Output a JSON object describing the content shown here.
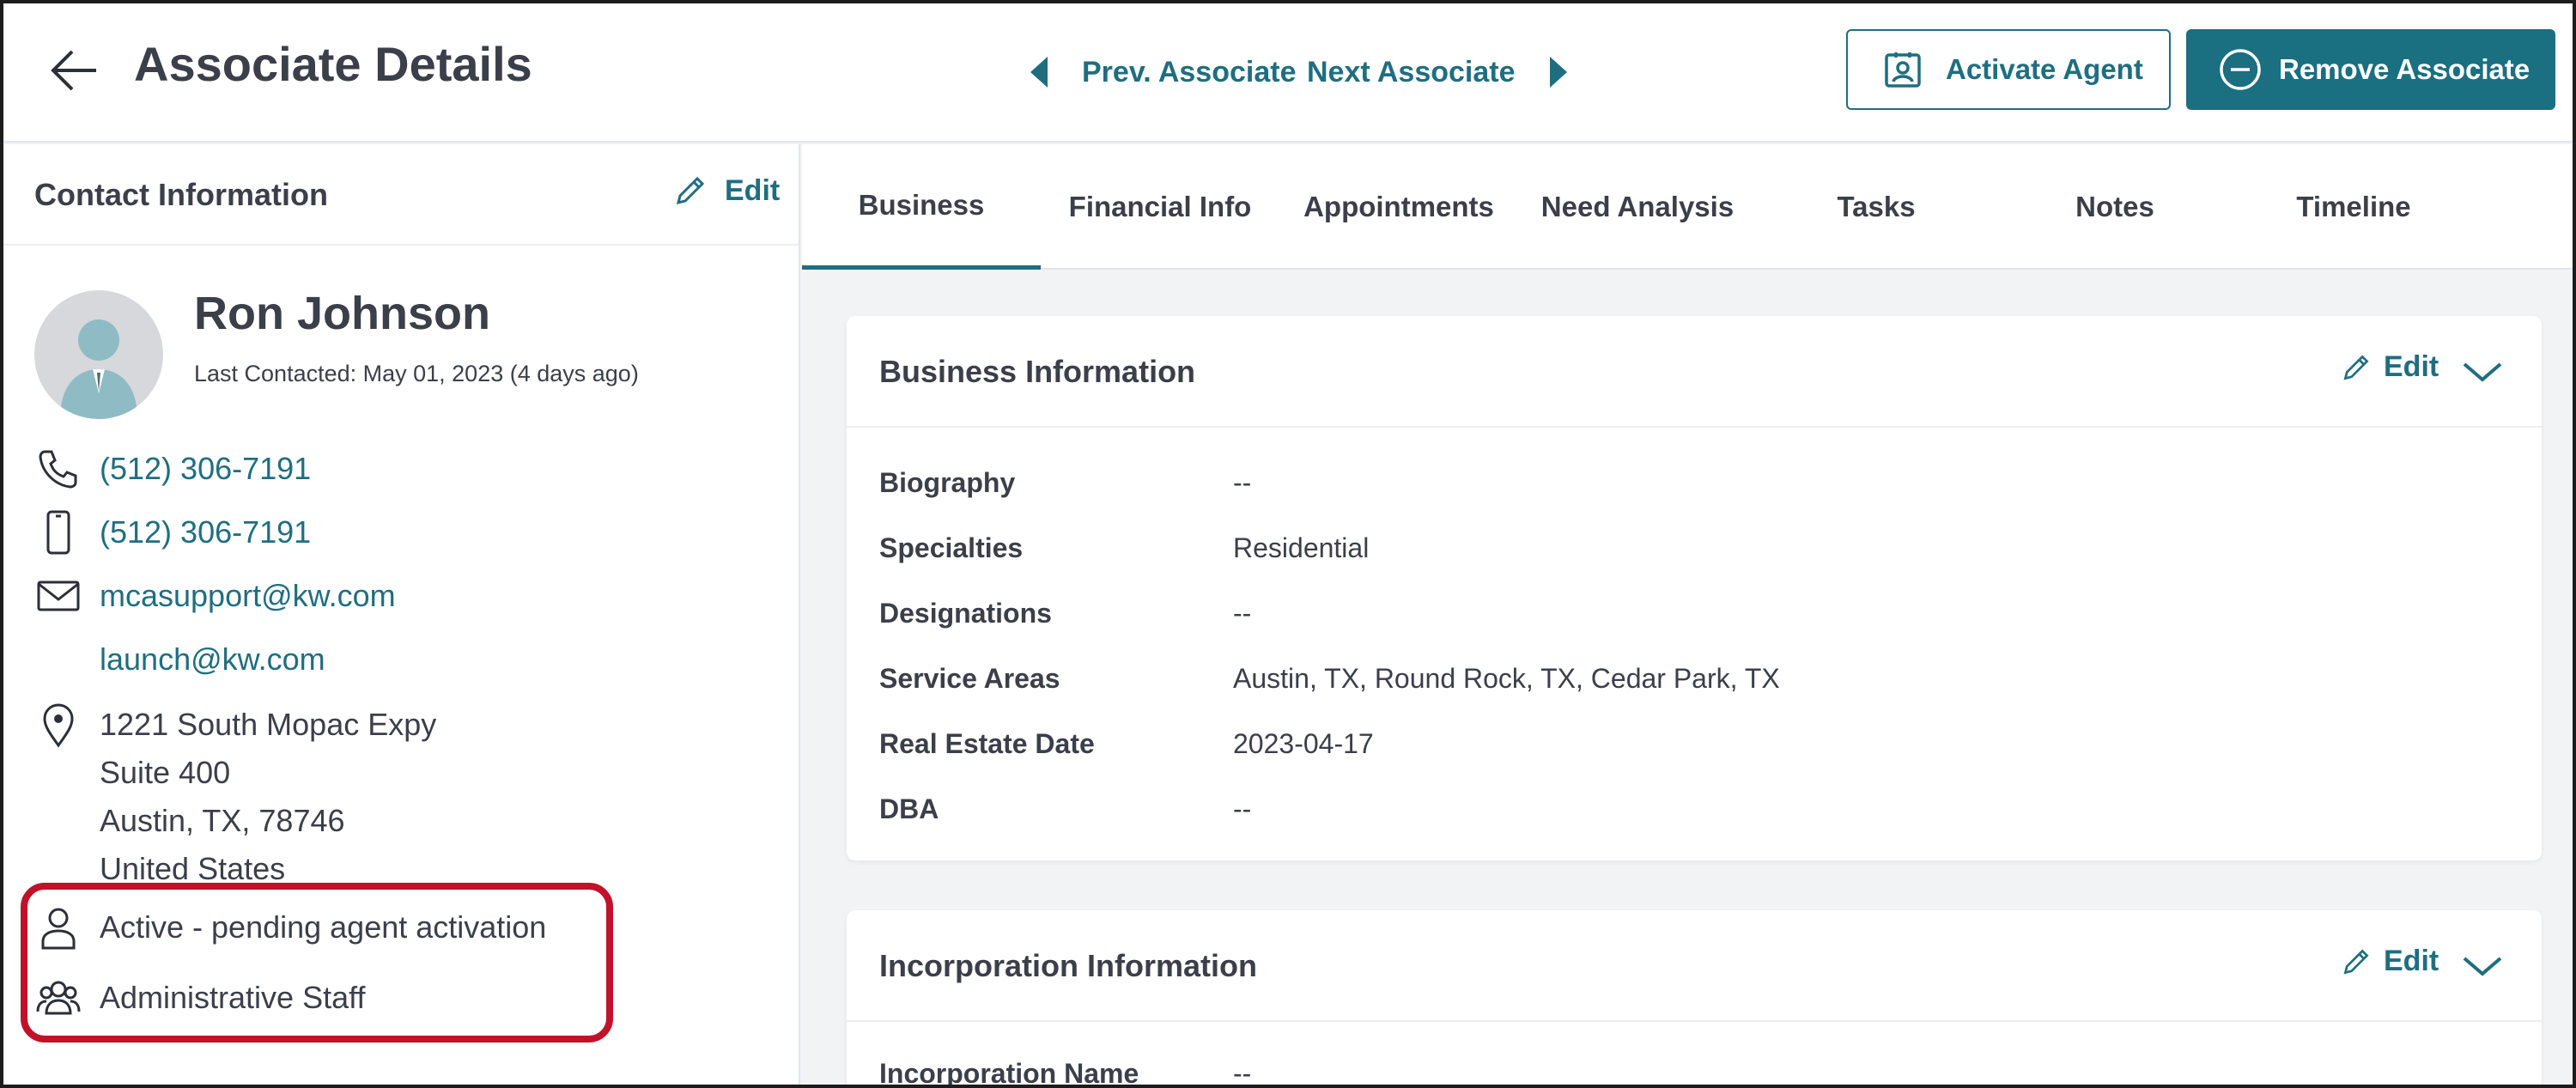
{
  "header": {
    "title": "Associate Details",
    "prev_label": "Prev. Associate",
    "next_label": "Next Associate",
    "activate_label": "Activate Agent",
    "remove_label": "Remove Associate"
  },
  "contact": {
    "section_title": "Contact Information",
    "edit_label": "Edit",
    "name": "Ron Johnson",
    "last_contacted": "Last Contacted: May 01, 2023 (4 days ago)",
    "phone": "(512) 306-7191",
    "mobile": "(512) 306-7191",
    "email_primary": "mcasupport@kw.com",
    "email_secondary": "launch@kw.com",
    "address": {
      "line1": "1221 South Mopac Expy",
      "line2": "Suite 400",
      "line3": "Austin, TX, 78746",
      "line4": "United States"
    },
    "status": "Active - pending agent activation",
    "role": "Administrative Staff"
  },
  "tabs": [
    {
      "label": "Business"
    },
    {
      "label": "Financial Info"
    },
    {
      "label": "Appointments"
    },
    {
      "label": "Need Analysis"
    },
    {
      "label": "Tasks"
    },
    {
      "label": "Notes"
    },
    {
      "label": "Timeline"
    }
  ],
  "active_tab": "Business",
  "business_card": {
    "title": "Business Information",
    "edit_label": "Edit",
    "fields": [
      {
        "label": "Biography",
        "value": "--"
      },
      {
        "label": "Specialties",
        "value": "Residential"
      },
      {
        "label": "Designations",
        "value": "--"
      },
      {
        "label": "Service Areas",
        "value": "Austin, TX, Round Rock, TX, Cedar Park, TX"
      },
      {
        "label": "Real Estate Date",
        "value": "2023-04-17"
      },
      {
        "label": "DBA",
        "value": "--"
      }
    ]
  },
  "incorporation_card": {
    "title": "Incorporation Information",
    "edit_label": "Edit",
    "fields": [
      {
        "label": "Incorporation Name",
        "value": "--"
      }
    ]
  },
  "colors": {
    "accent": "#1f6e80",
    "highlight": "#c0122a",
    "text": "#3b3f4a"
  }
}
